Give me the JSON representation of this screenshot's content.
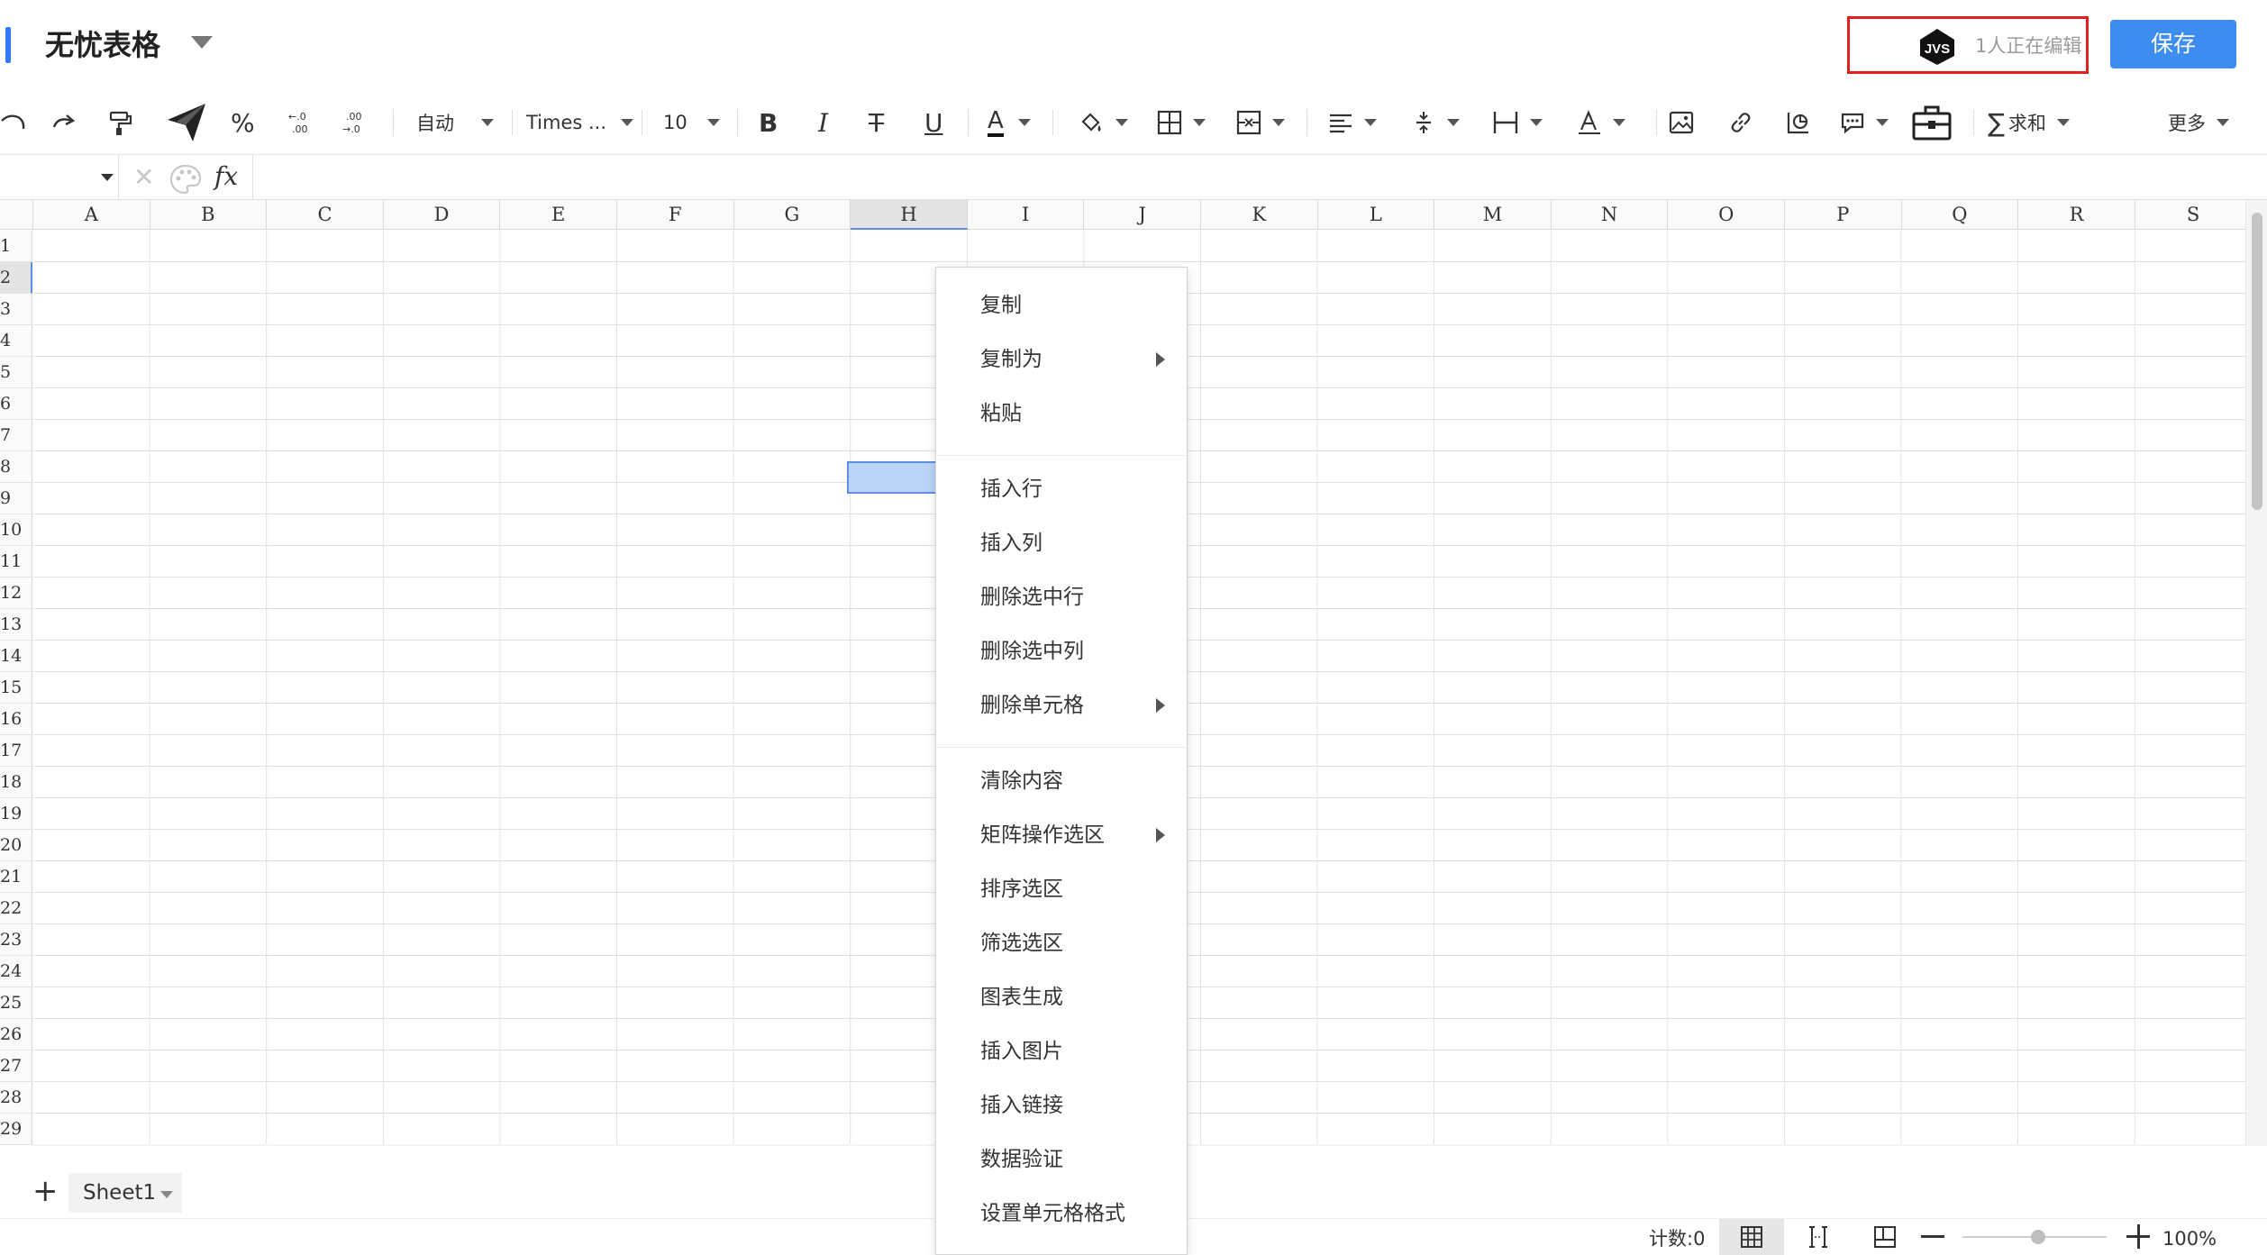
{
  "header": {
    "app_title": "无忧表格",
    "presence_avatar_text": "JVS",
    "presence_text": "1人正在编辑",
    "save_label": "保存"
  },
  "toolbar": {
    "number_format": "自动",
    "font_family": "Times ...",
    "font_size": "10",
    "bold_label": "B",
    "italic_label": "I",
    "strike_label": "T",
    "underline_label": "U",
    "font_color_label": "A",
    "text_color_label": "A",
    "percent_label": "%",
    "sum_label": "求和",
    "more_label": "更多"
  },
  "formula_bar": {
    "cancel_symbol": "✕",
    "fx_label": "fx"
  },
  "grid": {
    "columns": [
      "A",
      "B",
      "C",
      "D",
      "E",
      "F",
      "G",
      "H",
      "I",
      "J",
      "K",
      "L",
      "M",
      "N",
      "O",
      "P",
      "Q",
      "R",
      "S"
    ],
    "selected_column": "H",
    "rows": [
      "1",
      "2",
      "3",
      "4",
      "5",
      "6",
      "7",
      "8",
      "9",
      "10",
      "11",
      "12",
      "13",
      "14",
      "15",
      "16",
      "17",
      "18",
      "19",
      "20",
      "21",
      "22",
      "23",
      "24",
      "25",
      "26",
      "27",
      "28",
      "29"
    ],
    "selected_row": "2"
  },
  "context_menu": {
    "groups": [
      [
        {
          "label": "复制",
          "submenu": false
        },
        {
          "label": "复制为",
          "submenu": true
        },
        {
          "label": "粘贴",
          "submenu": false
        }
      ],
      [
        {
          "label": "插入行",
          "submenu": false
        },
        {
          "label": "插入列",
          "submenu": false
        },
        {
          "label": "删除选中行",
          "submenu": false
        },
        {
          "label": "删除选中列",
          "submenu": false
        },
        {
          "label": "删除单元格",
          "submenu": true
        }
      ],
      [
        {
          "label": "清除内容",
          "submenu": false
        },
        {
          "label": "矩阵操作选区",
          "submenu": true
        },
        {
          "label": "排序选区",
          "submenu": false
        },
        {
          "label": "筛选选区",
          "submenu": false
        },
        {
          "label": "图表生成",
          "submenu": false
        },
        {
          "label": "插入图片",
          "submenu": false
        },
        {
          "label": "插入链接",
          "submenu": false
        },
        {
          "label": "数据验证",
          "submenu": false
        },
        {
          "label": "设置单元格格式",
          "submenu": false
        }
      ]
    ]
  },
  "sheets": {
    "add_symbol": "+",
    "tabs": [
      "Sheet1"
    ]
  },
  "status_bar": {
    "count_label": "计数:0",
    "zoom": "100%"
  },
  "icons": {
    "undo": "undo-icon",
    "redo": "redo-icon",
    "format_painter": "format-painter-icon",
    "send": "send-icon",
    "decimal_increase": "decimal-increase-icon",
    "decimal_decrease": "decimal-decrease-icon",
    "fill_color": "fill-color-icon",
    "border": "border-icon",
    "merge": "merge-cells-icon",
    "align": "align-left-icon",
    "valign": "vertical-align-icon",
    "wrap": "text-wrap-icon",
    "rotate": "text-rotate-icon",
    "image": "image-icon",
    "link": "link-icon",
    "chart": "chart-icon",
    "comment": "comment-icon",
    "toolbox": "toolbox-icon",
    "sum": "sum-icon",
    "palette": "palette-icon"
  },
  "colors": {
    "accent": "#3d8cf0",
    "selection_fill": "#b9d4f6",
    "selection_border": "#5c8ee6",
    "presence_border": "#e02020"
  }
}
